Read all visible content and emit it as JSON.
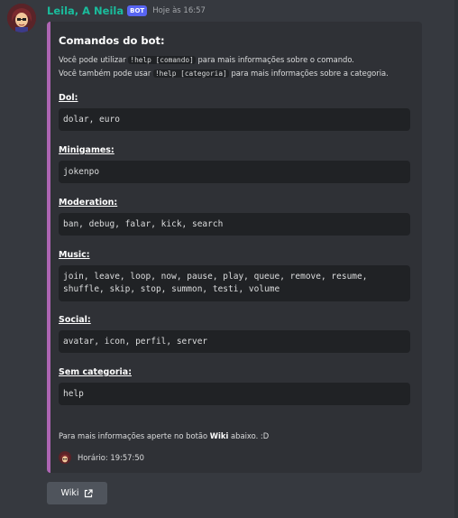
{
  "message": {
    "author": "Leila, A Neila",
    "bot_tag": "BOT",
    "timestamp": "Hoje às 16:57"
  },
  "embed": {
    "accent_color": "#ad65b3",
    "title": "Comandos do bot:",
    "description": {
      "line1_pre": "Você pode utilizar ",
      "line1_code": "!help [comando]",
      "line1_post": " para mais informações sobre o comando.",
      "line2_pre": "Você também pode usar ",
      "line2_code": "!help [categoria]",
      "line2_post": " para mais informações sobre a categoria."
    },
    "fields": [
      {
        "name": "Dol:",
        "value": "dolar, euro"
      },
      {
        "name": "Minigames:",
        "value": "jokenpo"
      },
      {
        "name": "Moderation:",
        "value": "ban, debug, falar, kick, search"
      },
      {
        "name": "Music:",
        "value_line1": "join, leave, loop, now, pause, play, queue, remove, resume,",
        "value_line2": "shuffle, skip, stop, summon, testi, volume"
      },
      {
        "name": "Social:",
        "value": "avatar, icon, perfil, server"
      },
      {
        "name": "Sem categoria:",
        "value": "help"
      }
    ],
    "footer_text_pre": "Para mais informações aperte no botão ",
    "footer_text_bold": "Wiki",
    "footer_text_post": " abaixo. :D",
    "footer_label": "Horário: 19:57:50"
  },
  "buttons": {
    "wiki_label": "Wiki",
    "wiki_icon": "external-link-icon"
  },
  "colors": {
    "background": "#36393f",
    "embed_background": "#2f3136",
    "code_background": "#202225",
    "username": "#1abc9c",
    "bot_tag": "#5865f2"
  }
}
